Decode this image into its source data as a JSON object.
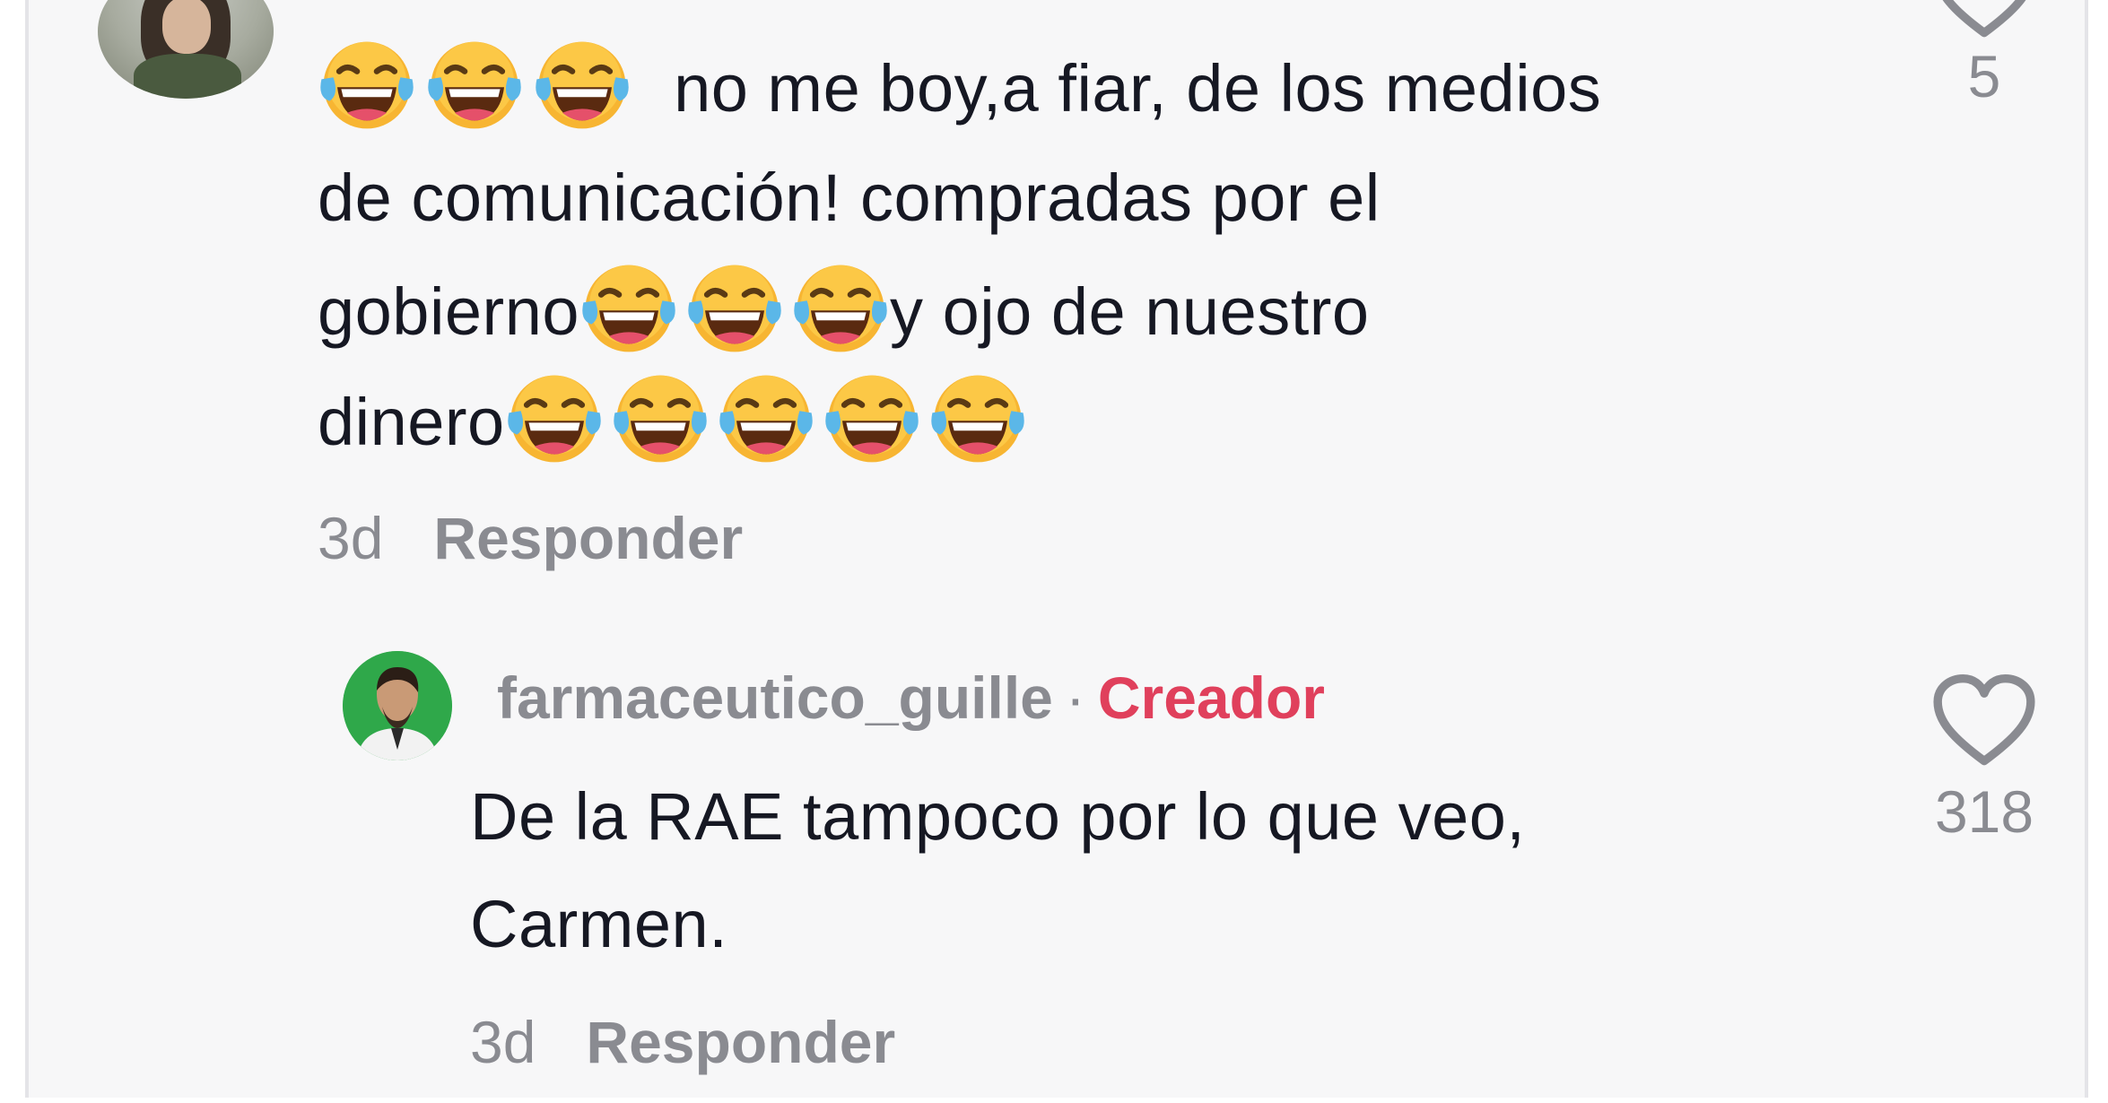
{
  "top_comment": {
    "line1_text": "no me boy,a fiar, de los medios",
    "line2_text": "de comunicación! compradas por el",
    "line3_text_before": "gobierno",
    "line3_text_after": "y ojo de nuestro",
    "line4_text": "dinero",
    "emoji_name": "face-with-tears-of-joy",
    "time": "3d",
    "reply_label": "Responder",
    "like_count": "5"
  },
  "reply_comment": {
    "username": "farmaceutico_guille",
    "separator": "·",
    "badge": "Creador",
    "line1_text": "De la RAE tampoco por lo que veo,",
    "line2_text": "Carmen.",
    "time": "3d",
    "reply_label": "Responder",
    "like_count": "318"
  },
  "colors": {
    "background": "#f7f7f8",
    "text": "#161823",
    "muted": "#8a8b91",
    "creator_badge": "#e0405c",
    "emoji_face": "#f7b532",
    "tear": "#5bb7e8"
  }
}
